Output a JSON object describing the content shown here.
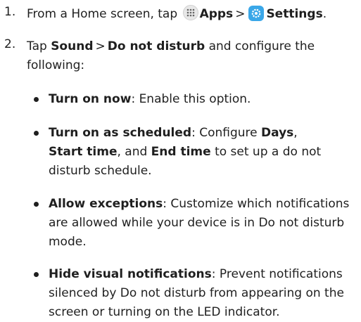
{
  "steps": [
    {
      "number": "1.",
      "pre": "From a Home screen, tap",
      "apps_label": "Apps",
      "sep": ">",
      "settings_label": "Settings",
      "end": "."
    },
    {
      "number": "2.",
      "pre": "Tap",
      "sound_label": "Sound",
      "sep": ">",
      "dnd_label": "Do not disturb",
      "rest": "and configure the following:"
    }
  ],
  "bullets": [
    {
      "term": "Turn on now",
      "desc": ": Enable this option."
    },
    {
      "term": "Turn on as scheduled",
      "desc_a": ": Configure",
      "days": "Days",
      "comma1": ",",
      "start": "Start time",
      "desc_b": ", and",
      "end": "End time",
      "desc_c": "to set up a do not disturb schedule."
    },
    {
      "term": "Allow exceptions",
      "desc": ": Customize which notifications are allowed while your device is in Do not disturb mode."
    },
    {
      "term": "Hide visual notifications",
      "desc": ": Prevent notifications silenced by Do not disturb from appearing on the screen or turning on the LED indicator."
    }
  ],
  "icons": {
    "apps": "apps-grid-icon",
    "settings": "settings-gear-icon"
  },
  "colors": {
    "text": "#1f1f1f",
    "settings_icon_bg": "#3aa7e8",
    "apps_icon_bg": "#e8e8e8"
  }
}
